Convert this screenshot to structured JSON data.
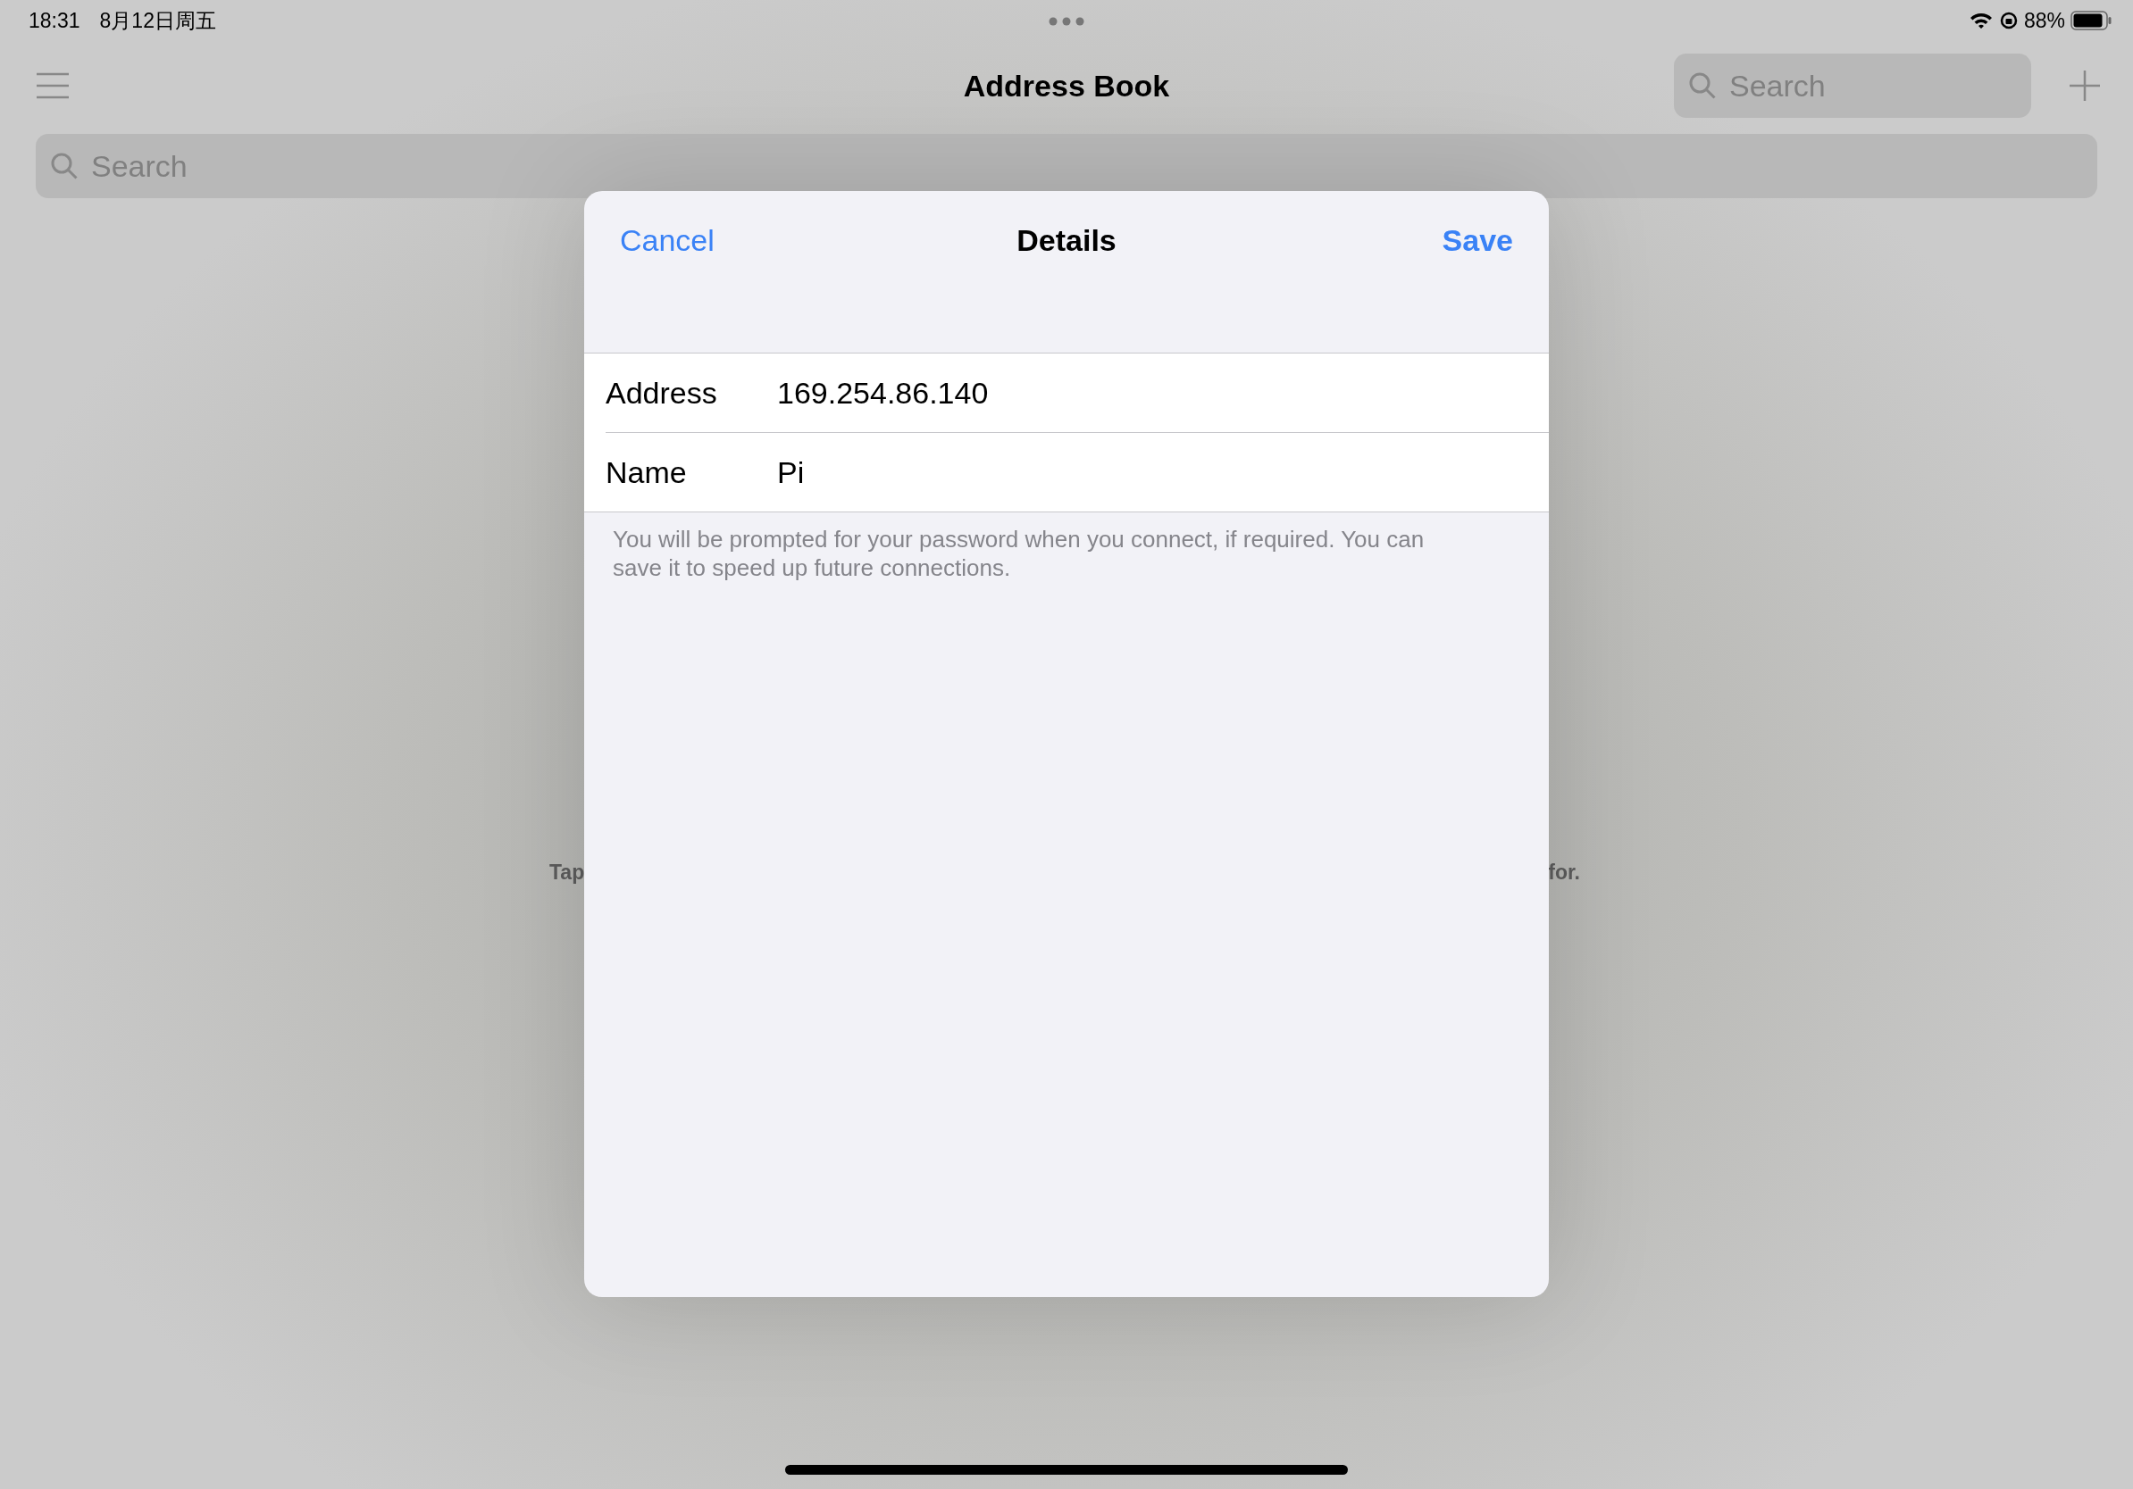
{
  "status_bar": {
    "time": "18:31",
    "date": "8月12日周五",
    "battery": "88%"
  },
  "nav": {
    "title": "Address Book",
    "search": {
      "placeholder": "Search"
    }
  },
  "search_bar": {
    "placeholder": "Search"
  },
  "background_hint": [
    "Tap",
    "for."
  ],
  "dialog": {
    "cancel": "Cancel",
    "title": "Details",
    "save": "Save",
    "fields": [
      {
        "label": "Address",
        "value": "169.254.86.140"
      },
      {
        "label": "Name",
        "value": "Pi"
      }
    ],
    "footnote": "You will be prompted for your password when you connect, if required. You can save it to speed up future connections."
  }
}
